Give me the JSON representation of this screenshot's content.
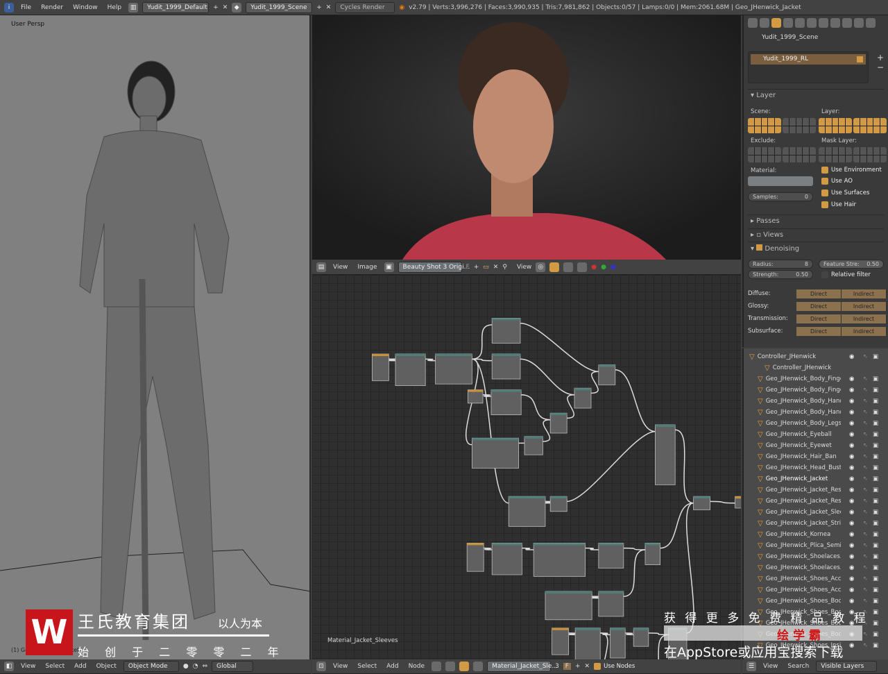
{
  "topbar": {
    "menus": [
      "File",
      "Render",
      "Window",
      "Help"
    ],
    "screen": "Yudit_1999_Default",
    "scene": "Yudit_1999_Scene",
    "engine": "Cycles Render",
    "stats": "v2.79 | Verts:3,996,276 | Faces:3,990,935 | Tris:7,981,862 | Objects:0/57 | Lamps:0/0 | Mem:2061.68M | Geo_JHenwick_Jacket"
  },
  "viewport": {
    "label": "User Persp",
    "object_label": "(1) Geo_JHenwick_Jacket"
  },
  "image_header": {
    "menus": [
      "View",
      "Image"
    ],
    "image": "Beauty Shot 3 Origi...",
    "f": "F",
    "view": "View"
  },
  "node_editor": {
    "material_label": "Material_Jacket_Sleeves"
  },
  "bottom_left": {
    "menus": [
      "View",
      "Select",
      "Add",
      "Object"
    ],
    "mode": "Object Mode",
    "orientation": "Global"
  },
  "bottom_nodes": {
    "menus": [
      "View",
      "Select",
      "Add",
      "Node"
    ],
    "material": "Material_Jacket_Sle...",
    "users": "3",
    "f": "F",
    "use_nodes": "Use Nodes"
  },
  "bottom_outliner": {
    "menus": [
      "View",
      "Search"
    ],
    "filter": "Visible Layers"
  },
  "properties": {
    "scene": "Yudit_1999_Scene",
    "render_layer": "Yudit_1999_RL",
    "layer_section": "Layer",
    "scene_label": "Scene:",
    "layer_label": "Layer:",
    "exclude_label": "Exclude:",
    "mask_label": "Mask Layer:",
    "material_label": "Material:",
    "samples_label": "Samples:",
    "samples": "0",
    "checks": [
      "Use Environment",
      "Use AO",
      "Use Surfaces",
      "Use Hair"
    ],
    "passes": "Passes",
    "views": "Views",
    "denoising": "Denoising",
    "radius_label": "Radius:",
    "radius": "8",
    "strength_label": "Strength:",
    "strength": "0.50",
    "feature_label": "Feature Stre:",
    "feature": "0.50",
    "relative": "Relative filter",
    "rows": [
      "Diffuse:",
      "Glossy:",
      "Transmission:",
      "Subsurface:"
    ],
    "direct": "Direct",
    "indirect": "Indirect"
  },
  "outliner": {
    "items": [
      "Controller_JHenwick",
      "Controller_JHenwick",
      "Geo_JHenwick_Body_Finge",
      "Geo_JHenwick_Body_Finge",
      "Geo_JHenwick_Body_Hand",
      "Geo_JHenwick_Body_Hand",
      "Geo_JHenwick_Body_Legs",
      "Geo_JHenwick_Eyeball",
      "Geo_JHenwick_Eyewet",
      "Geo_JHenwick_Hair_Ban",
      "Geo_JHenwick_Head_Bust",
      "Geo_JHenwick_Jacket",
      "Geo_JHenwick_Jacket_Resl",
      "Geo_JHenwick_Jacket_Resl",
      "Geo_JHenwick_Jacket_Slee",
      "Geo_JHenwick_Jacket_Strin",
      "Geo_JHenwick_Kornea",
      "Geo_JHenwick_Plica_Semil",
      "Geo_JHenwick_Shoelaces.L",
      "Geo_JHenwick_Shoelaces.R",
      "Geo_JHenwick_Shoes_Acce",
      "Geo_JHenwick_Shoes_Acce",
      "Geo_JHenwick_Shoes_Body",
      "Geo_JHenwick_Shoes_Body",
      "Geo_JHenwick_Shoes_Body",
      "Geo_JHenwick_Shoes_Body",
      "Geo_JHenwick_Shoes_Insid"
    ]
  },
  "watermark": {
    "logo": "W",
    "company": "王氏教育集团",
    "slogan": "以人为本",
    "founded": "始 创 于 二 零 零 二 年",
    "promo1": "获 得 更 多 免 费 精 品 教 程",
    "promo2": "绘 学 霸",
    "promo3": "在AppStore或应用宝搜索下载"
  },
  "colors": {
    "accent": "#d39a45",
    "node_header": "#4f7d7a",
    "watermark_red": "#c8141b"
  }
}
